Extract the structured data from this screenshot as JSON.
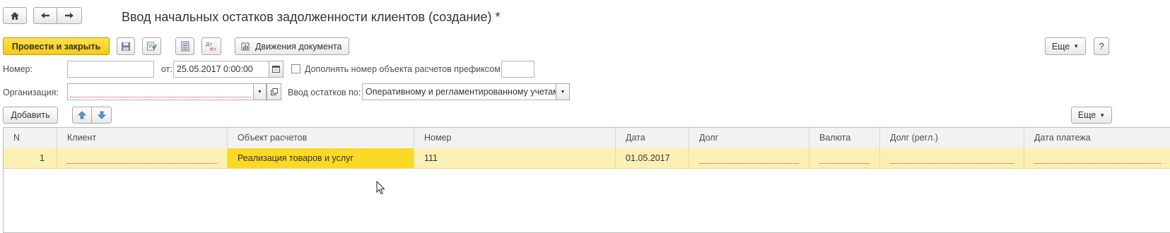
{
  "window": {
    "title": "Ввод начальных остатков задолженности клиентов (создание) *"
  },
  "toolbar": {
    "post_close_label": "Провести и закрыть",
    "movements_label": "Движения документа",
    "more_label": "Еще",
    "help_label": "?"
  },
  "form": {
    "number_label": "Номер:",
    "number_value": "",
    "from_label": "от:",
    "date_value": "25.05.2017  0:00:00",
    "prefix_checkbox_label": "Дополнять номер объекта расчетов префиксом",
    "prefix_value": "",
    "org_label": "Организация:",
    "org_value": "",
    "balance_label": "Ввод остатков по:",
    "balance_value": "Оперативному и регламентированному учетам"
  },
  "table_toolbar": {
    "add_label": "Добавить",
    "more_label": "Еще"
  },
  "table": {
    "columns": [
      "N",
      "Клиент",
      "Объект расчетов",
      "Номер",
      "Дата",
      "Долг",
      "Валюта",
      "Долг (регл.)",
      "Дата платежа"
    ],
    "rows": [
      {
        "n": "1",
        "client": "",
        "object": "Реализация товаров и услуг",
        "number": "111",
        "date": "01.05.2017",
        "debt": "",
        "currency": "",
        "debt_reg": "",
        "pay_date": ""
      }
    ]
  },
  "colors": {
    "accent_yellow": "#f6c915",
    "selected_row": "#fbf0b4",
    "selected_cell": "#fcd924",
    "required_red": "#e53030"
  },
  "icons": [
    "home-icon",
    "back-arrow-icon",
    "forward-arrow-icon",
    "save-icon",
    "post-icon",
    "report-icon",
    "dt-kt-icon",
    "movements-icon",
    "calendar-icon",
    "dropdown-arrow-icon",
    "open-icon",
    "move-up-icon",
    "move-down-icon",
    "mouse-cursor-icon"
  ]
}
